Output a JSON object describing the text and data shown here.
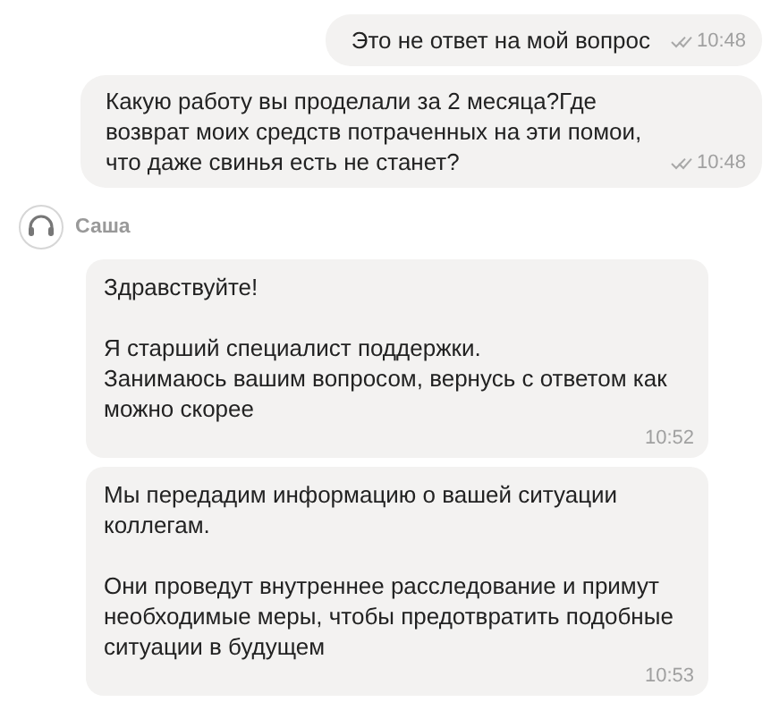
{
  "messages": [
    {
      "kind": "outgoing",
      "text": "Это не ответ на мой вопрос",
      "time": "10:48",
      "read": true
    },
    {
      "kind": "outgoing",
      "text": "Какую работу вы проделали за 2 месяца?Где возврат моих средств потраченных на эти помои, что даже свинья есть не станет?",
      "time": "10:48",
      "read": true
    },
    {
      "kind": "incoming",
      "sender": "Саша",
      "text": "Здравствуйте!\n\nЯ старший специалист поддержки.\nЗанимаюсь вашим вопросом, вернусь с ответом как можно скорее",
      "time": "10:52"
    },
    {
      "kind": "incoming",
      "text": "Мы передадим информацию о вашей ситуации коллегам.\n\nОни проведут внутреннее расследование и примут необходимые меры, чтобы предотвратить подобные ситуации в будущем",
      "time": "10:53"
    }
  ]
}
